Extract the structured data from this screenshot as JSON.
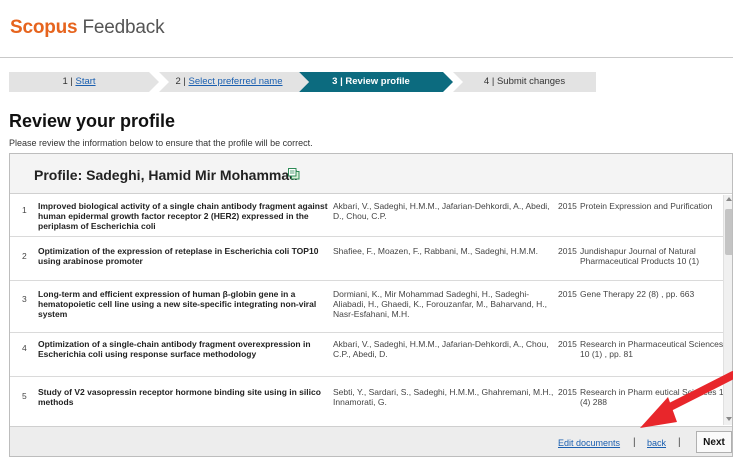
{
  "header": {
    "brand": "Scopus",
    "product": "Feedback"
  },
  "steps": [
    {
      "number": "1",
      "label": "Start"
    },
    {
      "number": "2",
      "label": "Select preferred name"
    },
    {
      "number": "3",
      "label": "Review profile"
    },
    {
      "number": "4",
      "label": "Submit changes"
    }
  ],
  "page": {
    "title": "Review your profile",
    "intro": "Please review the information below to ensure that the profile will be correct."
  },
  "profile": {
    "name": "Profile: Sadeghi, Hamid Mir Mohammad"
  },
  "documents": [
    {
      "num": "1",
      "title": "Improved biological activity of a single chain antibody fragment against human epidermal growth factor receptor 2 (HER2) expressed in the periplasm of Escherichia coli",
      "authors": "Akbari, V., Sadeghi, H.M.M., Jafarian-Dehkordi, A., Abedi, D., Chou, C.P.",
      "year": "2015",
      "source": "Protein Expression and Purification"
    },
    {
      "num": "2",
      "title": "Optimization of the expression of reteplase in Escherichia coli TOP10 using arabinose promoter",
      "authors": "Shafiee, F., Moazen, F., Rabbani, M., Sadeghi, H.M.M.",
      "year": "2015",
      "source": "Jundishapur Journal of Natural Pharmaceutical Products 10 (1)"
    },
    {
      "num": "3",
      "title": "Long-term and efficient expression of human β-globin gene in a hematopoietic cell line using a new site-specific integrating non-viral system",
      "authors": "Dormiani, K., Mir Mohammad Sadeghi, H., Sadeghi-Aliabadi, H., Ghaedi, K., Forouzanfar, M., Baharvand, H., Nasr-Esfahani, M.H.",
      "year": "2015",
      "source": "Gene Therapy 22 (8) , pp. 663"
    },
    {
      "num": "4",
      "title": "Optimization of a single-chain antibody fragment overexpression in Escherichia coli using response surface methodology",
      "authors": "Akbari, V., Sadeghi, H.M.M., Jafarian-Dehkordi, A., Chou, C.P., Abedi, D.",
      "year": "2015",
      "source": "Research in Pharmaceutical Sciences 10 (1) , pp. 81"
    },
    {
      "num": "5",
      "title": "Study of V2 vasopressin receptor hormone binding site using in silico methods",
      "authors": "Sebti, Y., Sardari, S., Sadeghi, H.M.M., Ghahremani, M.H., Innamorati, G.",
      "year": "2015",
      "source": "Research in Pharm   eutical Sciences 10 (4)    288"
    }
  ],
  "footer": {
    "edit_label": "Edit documents",
    "separator": "|",
    "back_label": "back",
    "next_label": "Next"
  },
  "colors": {
    "brand": "#e6641e",
    "active_step": "#0c6b7f",
    "link": "#1a5fb0",
    "annotation_arrow": "#e8262b"
  }
}
